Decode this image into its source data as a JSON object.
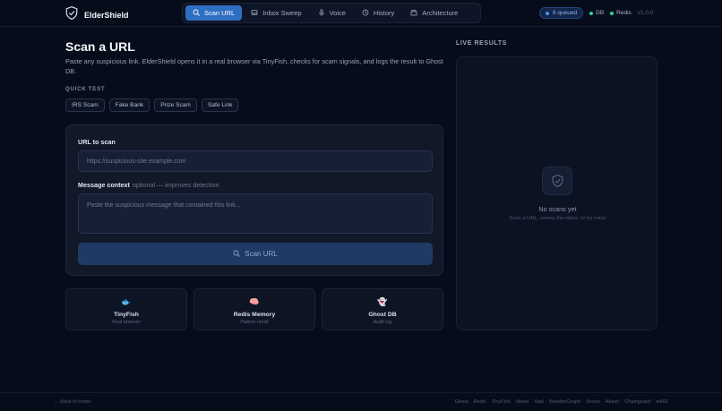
{
  "brand": {
    "name": "ElderShield"
  },
  "nav": [
    {
      "label": "Scan URL",
      "icon": "search-icon",
      "active": true
    },
    {
      "label": "Inbox Sweep",
      "icon": "inbox-icon",
      "active": false
    },
    {
      "label": "Voice",
      "icon": "mic-icon",
      "active": false
    },
    {
      "label": "History",
      "icon": "clock-icon",
      "active": false
    },
    {
      "label": "Architecture",
      "icon": "layers-icon",
      "active": false
    }
  ],
  "header_status": {
    "queued": "6 queued",
    "db": "DB",
    "redis": "Redis",
    "version": "v1.0.0"
  },
  "page": {
    "title": "Scan a URL",
    "subtitle": "Paste any suspicious link. ElderShield opens it in a real browser via TinyFish, checks for scam signals, and logs the result to Ghost DB."
  },
  "quick_test": {
    "label": "QUICK TEST",
    "chips": [
      "IRS Scam",
      "Fake Bank",
      "Prize Scam",
      "Safe Link"
    ]
  },
  "form": {
    "url_label": "URL to scan",
    "url_placeholder": "https://suspicious-site.example.com",
    "context_label": "Message context",
    "context_hint": "optional — improves detection",
    "context_placeholder": "Paste the suspicious message that contained this link...",
    "scan_button": "Scan URL"
  },
  "tiles": [
    {
      "icon": "🐟",
      "name": "TinyFish",
      "sub": "Real browser"
    },
    {
      "icon": "🧠",
      "name": "Redis Memory",
      "sub": "Pattern recall"
    },
    {
      "icon": "👻",
      "name": "Ghost DB",
      "sub": "Audit log"
    }
  ],
  "live": {
    "label": "LIVE RESULTS",
    "empty_title": "No scans yet",
    "empty_sub": "Scan a URL, sweep the inbox, or try voice"
  },
  "footer": {
    "back": "← Back to home",
    "partners": [
      "Ghost",
      "Redis",
      "TinyFish",
      "Nexla",
      "Vapi",
      "WunderGraph",
      "Senso",
      "Akash",
      "Chainguard",
      "ai492"
    ]
  },
  "colors": {
    "accent": "#2f6fc2",
    "background": "#070c1a",
    "status_green": "#34d399",
    "queued_dot": "#4f8ff7"
  }
}
